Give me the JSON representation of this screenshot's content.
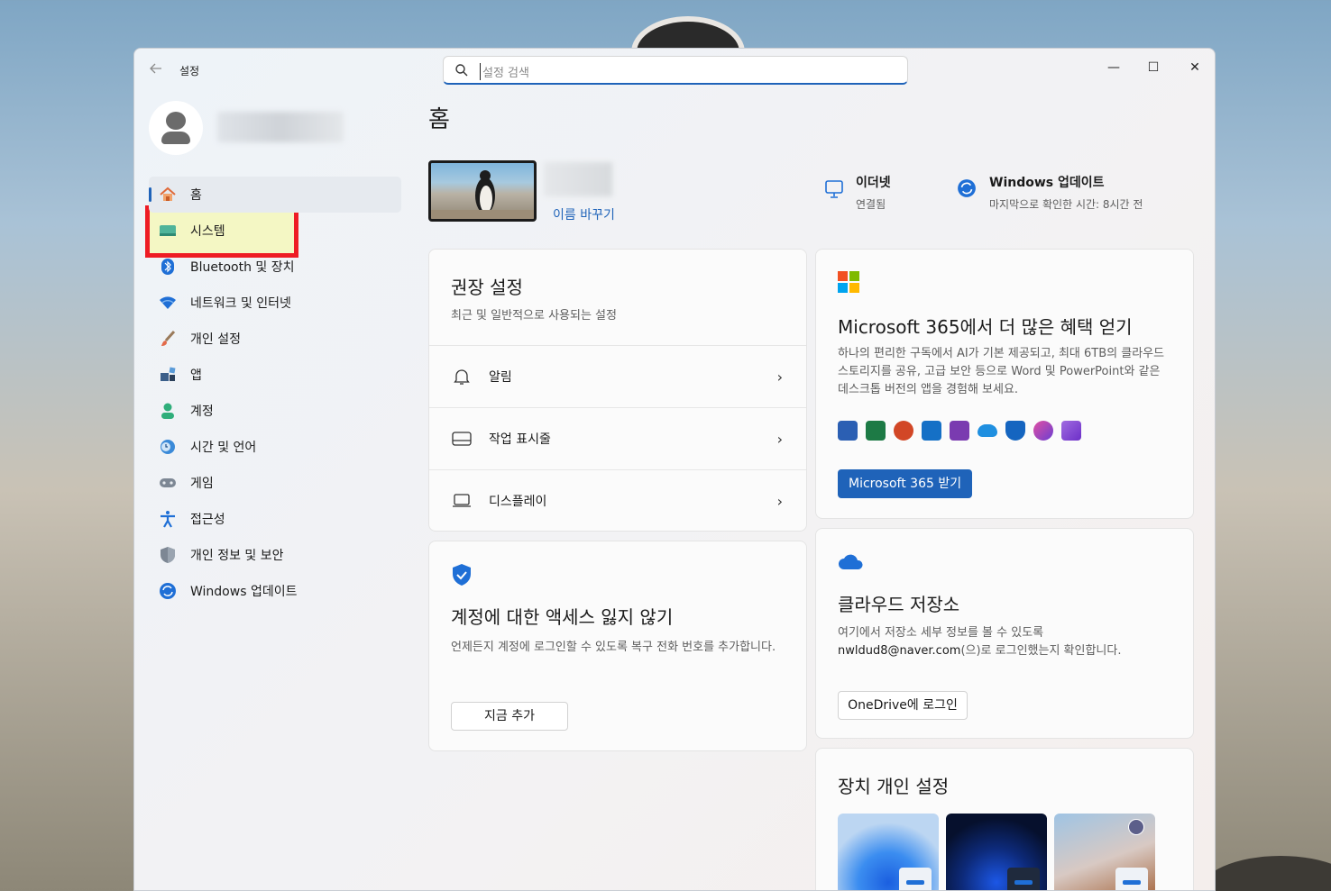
{
  "window": {
    "title": "설정",
    "minimize_icon": "—",
    "maximize_icon": "☐",
    "close_icon": "✕"
  },
  "search": {
    "placeholder": "설정 검색"
  },
  "sidebar": {
    "items": [
      {
        "label": "홈",
        "icon": "home-icon"
      },
      {
        "label": "시스템",
        "icon": "system-icon"
      },
      {
        "label": "Bluetooth 및 장치",
        "icon": "bluetooth-icon"
      },
      {
        "label": "네트워크 및 인터넷",
        "icon": "wifi-icon"
      },
      {
        "label": "개인 설정",
        "icon": "brush-icon"
      },
      {
        "label": "앱",
        "icon": "apps-icon"
      },
      {
        "label": "계정",
        "icon": "account-icon"
      },
      {
        "label": "시간 및 언어",
        "icon": "clock-globe-icon"
      },
      {
        "label": "게임",
        "icon": "gamepad-icon"
      },
      {
        "label": "접근성",
        "icon": "accessibility-icon"
      },
      {
        "label": "개인 정보 및 보안",
        "icon": "shield-icon"
      },
      {
        "label": "Windows 업데이트",
        "icon": "update-icon"
      }
    ]
  },
  "main": {
    "title": "홈",
    "device": {
      "rename_link": "이름 바꾸기"
    },
    "status": {
      "ethernet": {
        "title": "이더넷",
        "sub": "연결됨"
      },
      "update": {
        "title": "Windows 업데이트",
        "sub": "마지막으로 확인한 시간: 8시간 전"
      }
    },
    "recommended": {
      "title": "권장 설정",
      "sub": "최근 및 일반적으로 사용되는 설정",
      "rows": [
        {
          "label": "알림",
          "icon": "bell-icon"
        },
        {
          "label": "작업 표시줄",
          "icon": "taskbar-icon"
        },
        {
          "label": "디스플레이",
          "icon": "display-icon"
        }
      ]
    },
    "account_card": {
      "title": "계정에 대한 액세스 잃지 않기",
      "sub": "언제든지 계정에 로그인할 수 있도록 복구 전화 번호를 추가합니다.",
      "button": "지금 추가"
    },
    "ms365_card": {
      "title": "Microsoft 365에서 더 많은 혜택 얻기",
      "sub": "하나의 편리한 구독에서 AI가 기본 제공되고, 최대 6TB의 클라우드 스토리지를 공유, 고급 보안 등으로 Word 및 PowerPoint와 같은 데스크톱 버전의 앱을 경험해 보세요.",
      "button": "Microsoft 365 받기",
      "apps": [
        "word-icon",
        "excel-icon",
        "powerpoint-icon",
        "outlook-icon",
        "onenote-icon",
        "onedrive-icon",
        "defender-icon",
        "copilot-icon",
        "clipchamp-icon"
      ]
    },
    "cloud_card": {
      "title": "클라우드 저장소",
      "sub_line1": "여기에서 저장소 세부 정보를 볼 수 있도록",
      "email": "nwldud8@naver.com",
      "sub_line2": "(으)로 로그인했는지 확인합니다.",
      "button": "OneDrive에 로그인"
    },
    "personalize_card": {
      "title": "장치 개인 설정"
    }
  }
}
